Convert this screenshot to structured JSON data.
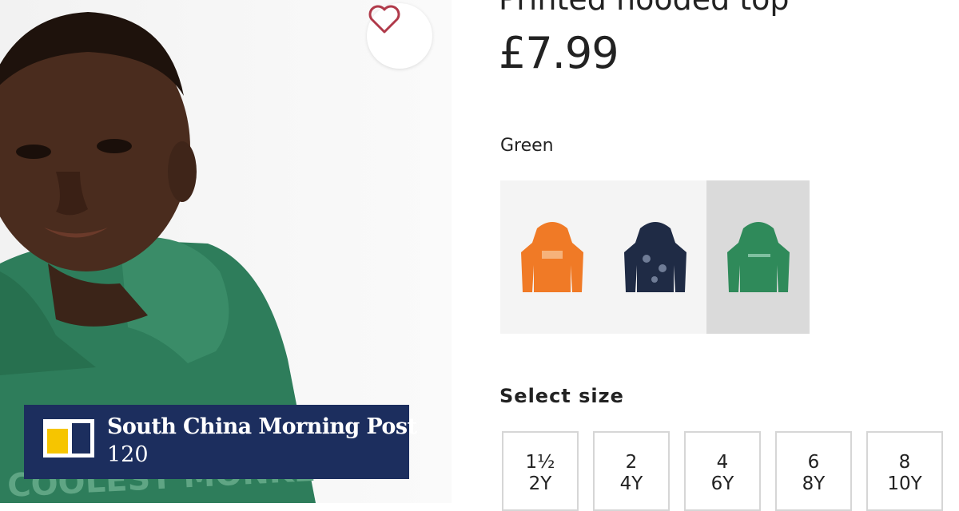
{
  "product": {
    "title": "Printed hooded top",
    "price": "£7.99",
    "color_name": "Green",
    "size_heading": "Select size",
    "swatches": [
      {
        "name": "orange",
        "color": "#f07a26"
      },
      {
        "name": "navy",
        "color": "#1f2b45"
      },
      {
        "name": "green",
        "color": "#2f8a5a",
        "selected": true
      }
    ],
    "sizes": [
      {
        "line1": "1½",
        "line2": "2Y"
      },
      {
        "line1": "2",
        "line2": "4Y"
      },
      {
        "line1": "4",
        "line2": "6Y"
      },
      {
        "line1": "6",
        "line2": "8Y"
      },
      {
        "line1": "8",
        "line2": "10Y"
      }
    ]
  },
  "photo": {
    "hoodie_text": "COOLEST MONKE",
    "hoodie_color": "#2e7d5b"
  },
  "banner": {
    "name": "South China Morning Post",
    "subtitle": "120",
    "background": "#1c2e5e",
    "accent": "#f6c500"
  },
  "icons": {
    "favorite": "heart-icon"
  }
}
